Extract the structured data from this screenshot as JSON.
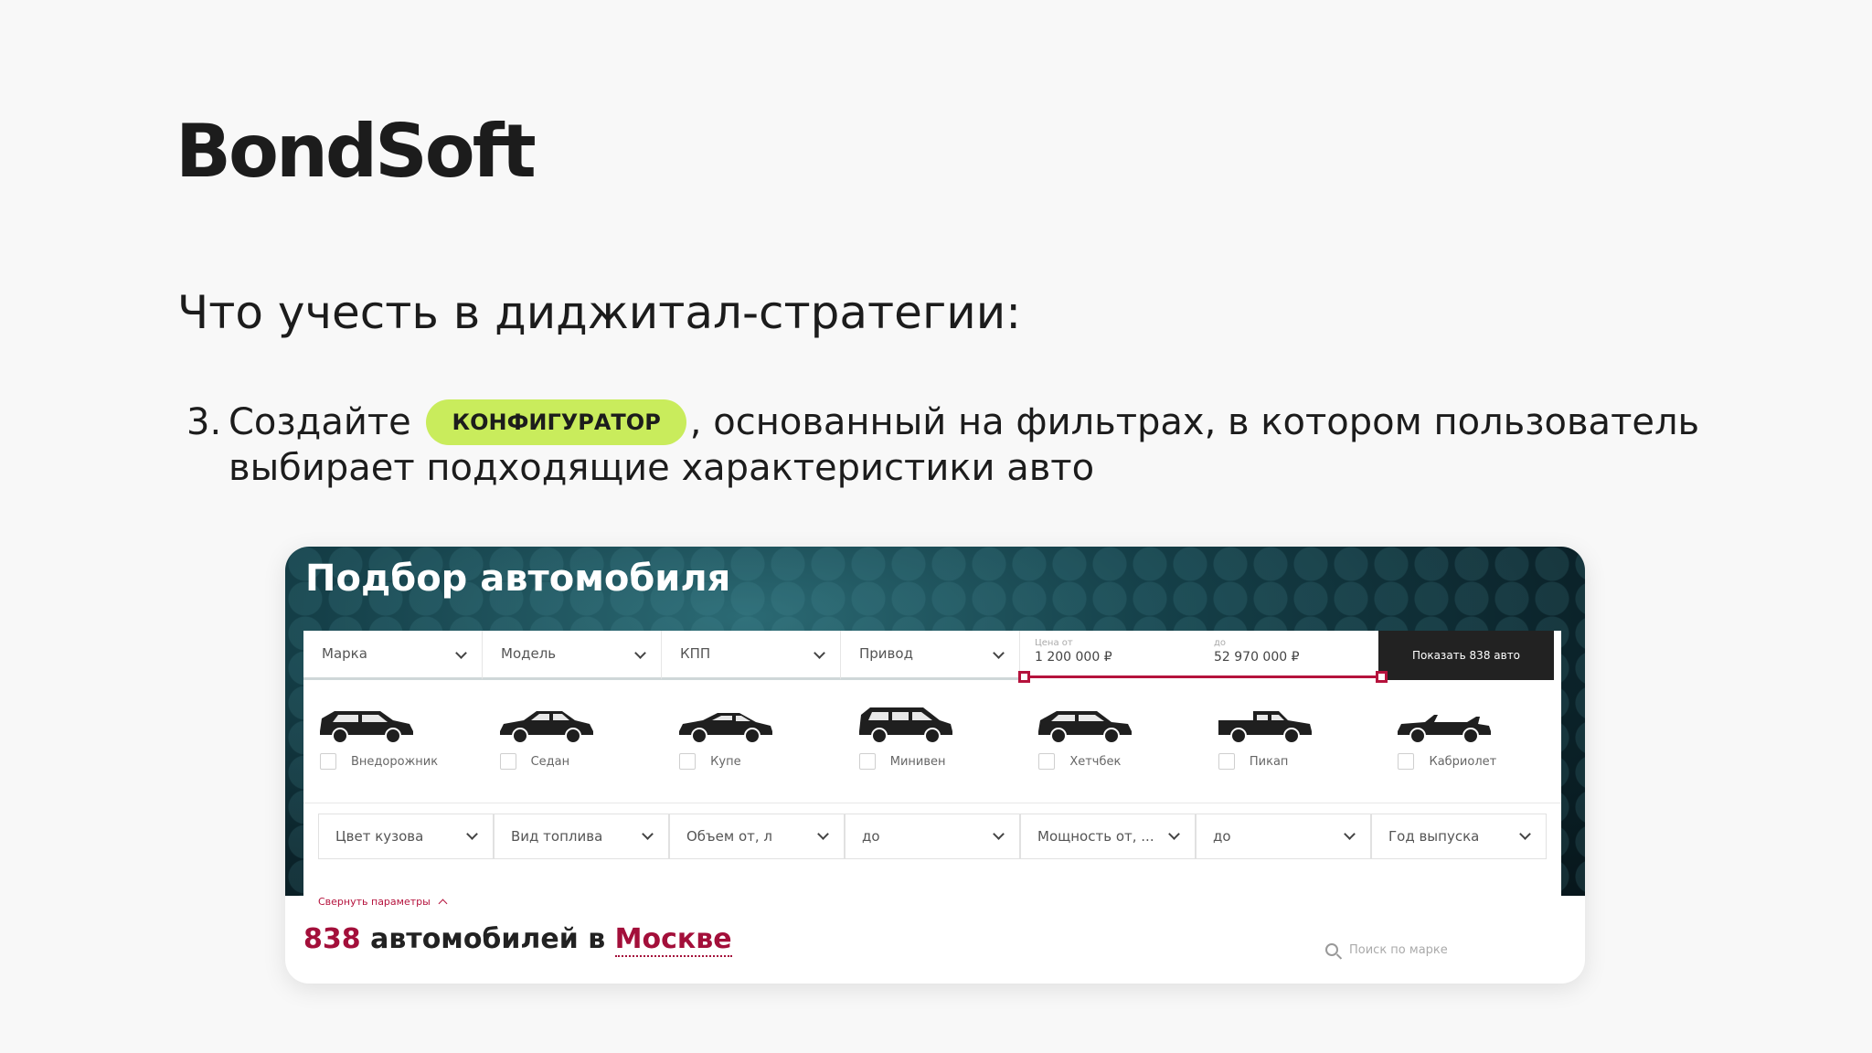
{
  "brand": {
    "logo_text": "BondSoft"
  },
  "heading": "Что учесть в диджитал-стратегии:",
  "point": {
    "number": "3.",
    "before": "Создайте",
    "badge": "КОНФИГУРАТОР",
    "after": ", основанный на фильтрах, в котором пользователь",
    "line2": "выбирает подходящие характеристики авто"
  },
  "screenshot": {
    "title": "Подбор автомобиля",
    "filters": [
      {
        "label": "Марка"
      },
      {
        "label": "Модель"
      },
      {
        "label": "КПП"
      },
      {
        "label": "Привод"
      }
    ],
    "price": {
      "from_label": "Цена от",
      "from_value": "1 200 000 ₽",
      "to_label": "до",
      "to_value": "52 970 000 ₽"
    },
    "show_button": "Показать 838 авто",
    "body_types": [
      {
        "label": "Внедорожник",
        "icon": "suv-icon"
      },
      {
        "label": "Седан",
        "icon": "sedan-icon"
      },
      {
        "label": "Купе",
        "icon": "coupe-icon"
      },
      {
        "label": "Минивен",
        "icon": "minivan-icon"
      },
      {
        "label": "Хетчбек",
        "icon": "hatchback-icon"
      },
      {
        "label": "Пикап",
        "icon": "pickup-icon"
      },
      {
        "label": "Кабриолет",
        "icon": "cabriolet-icon"
      }
    ],
    "filters2": [
      {
        "label": "Цвет кузова"
      },
      {
        "label": "Вид топлива"
      },
      {
        "label": "Объем от, л"
      },
      {
        "label": "до"
      },
      {
        "label": "Мощность от, ..."
      },
      {
        "label": "до"
      },
      {
        "label": "Год выпуска"
      }
    ],
    "collapse": "Свернуть параметры",
    "count_number": "838",
    "count_text": "автомобилей в",
    "count_city": "Москве",
    "search_placeholder": "Поиск по марке"
  },
  "colors": {
    "accent": "#c9ec5c",
    "brand_red": "#a30f3a"
  }
}
